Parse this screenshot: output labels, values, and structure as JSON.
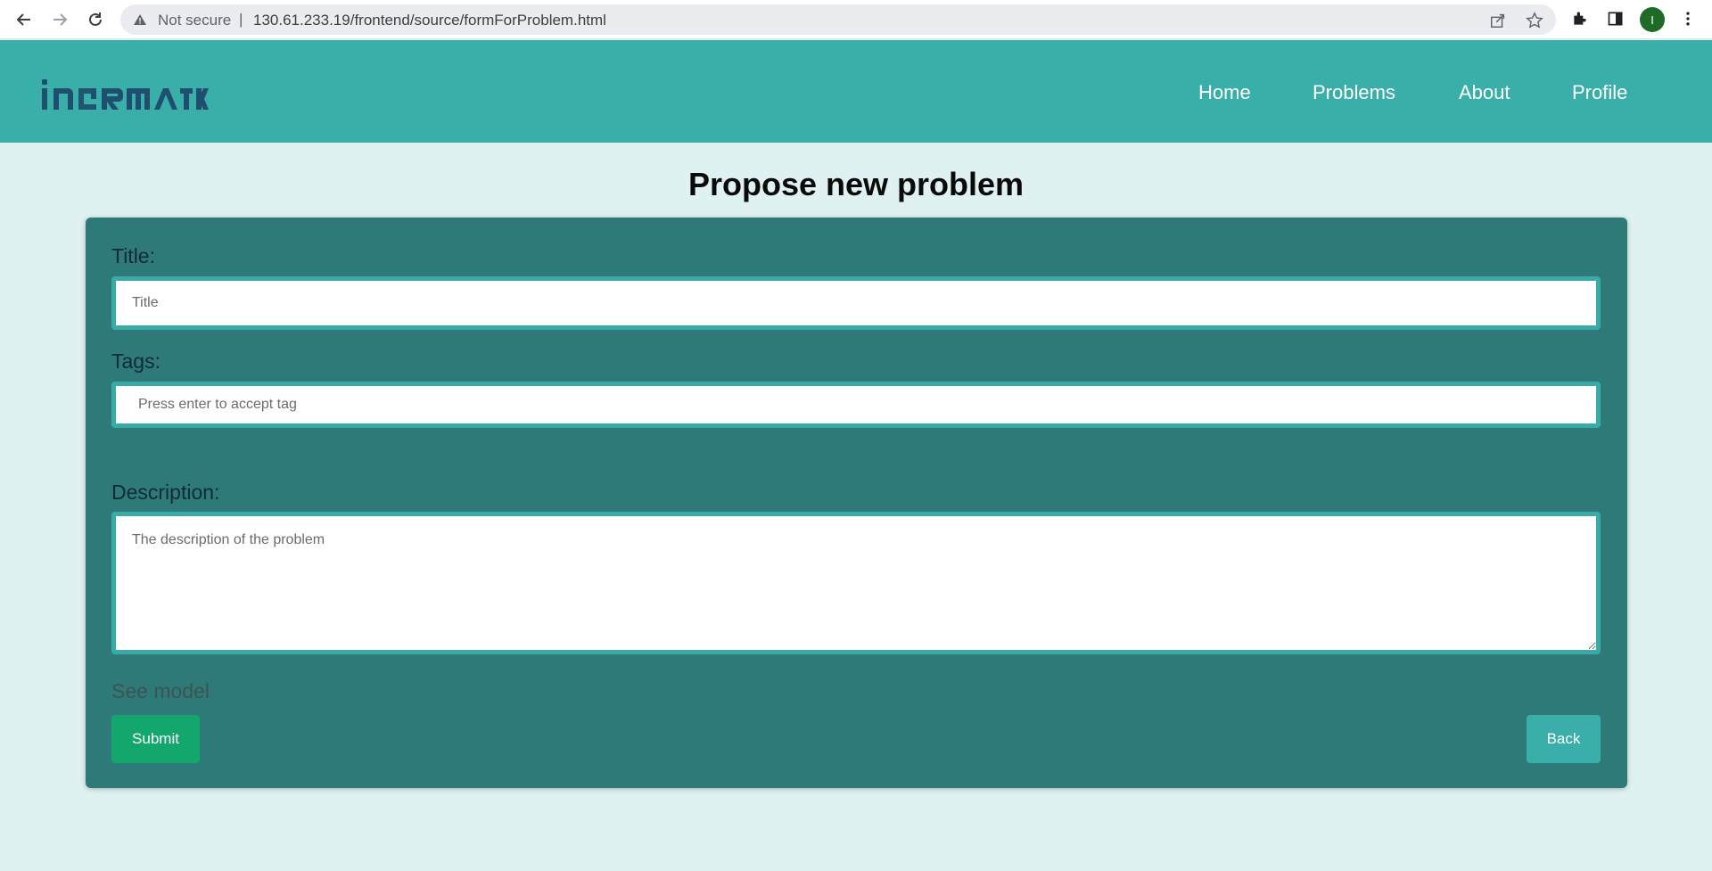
{
  "browser": {
    "security_label": "Not secure",
    "separator": "|",
    "url": "130.61.233.19/frontend/source/formForProblem.html",
    "profile_initial": "I",
    "profile_color": "#1e6a27"
  },
  "header": {
    "logo_text": "infORMATIX",
    "brand_color": "#3aaea9",
    "nav": [
      {
        "label": "Home"
      },
      {
        "label": "Problems"
      },
      {
        "label": "About"
      },
      {
        "label": "Profile"
      }
    ]
  },
  "main": {
    "title": "Propose new problem",
    "form": {
      "title_label": "Title:",
      "title_placeholder": "Title",
      "tags_label": "Tags:",
      "tags_placeholder": "Press enter to accept tag",
      "description_label": "Description:",
      "description_placeholder": "The description of the problem",
      "see_model_label": "See model",
      "submit_label": "Submit",
      "back_label": "Back"
    }
  },
  "colors": {
    "card_background": "#2e7a78",
    "input_border": "#39aba6",
    "submit_button": "#13a76e",
    "back_button": "#3aaea9",
    "page_background": "#dff1f0"
  }
}
